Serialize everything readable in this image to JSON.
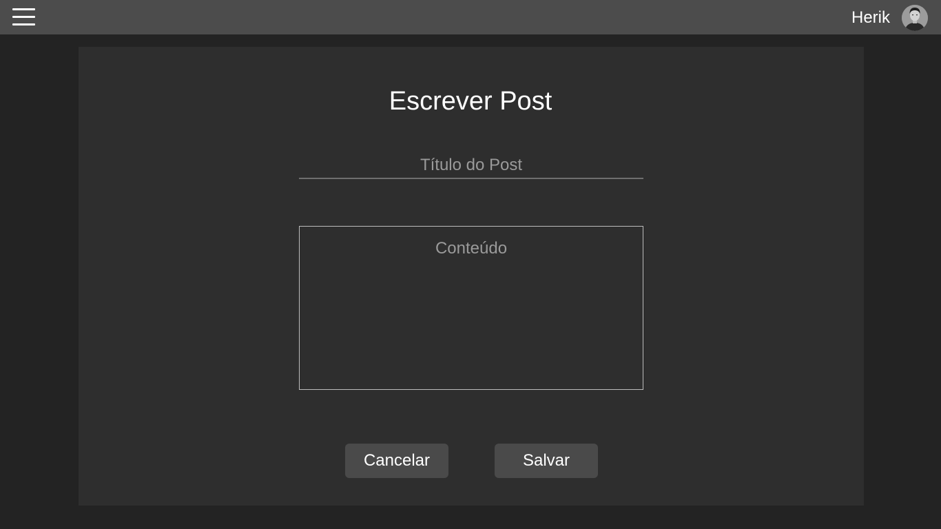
{
  "header": {
    "user_name": "Herik"
  },
  "form": {
    "heading": "Escrever Post",
    "title_placeholder": "Título do Post",
    "title_value": "",
    "content_placeholder": "Conteúdo",
    "content_value": ""
  },
  "actions": {
    "cancel_label": "Cancelar",
    "save_label": "Salvar"
  },
  "icons": {
    "menu": "hamburger-menu-icon",
    "avatar": "user-avatar"
  },
  "colors": {
    "topbar": "#4c4c4c",
    "background": "#232323",
    "panel": "#2e2e2e",
    "button": "#4a4a4a"
  }
}
